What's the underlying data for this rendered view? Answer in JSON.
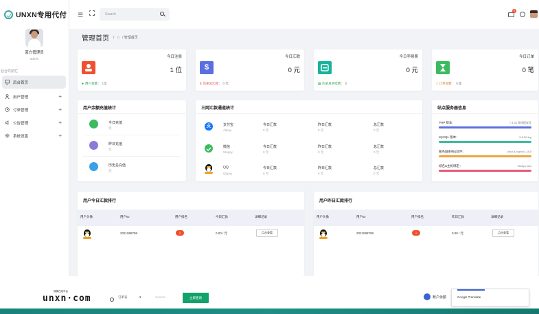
{
  "brand": {
    "name": "UNXN专用代付"
  },
  "user": {
    "name": "蓝方管理员",
    "role": "admin"
  },
  "nav": {
    "section_title": "后台导航栏",
    "items": [
      {
        "label": "后台首页",
        "icon": "monitor-icon",
        "active": true
      },
      {
        "label": "用户管理",
        "icon": "user-icon",
        "expandable": true
      },
      {
        "label": "订单管理",
        "icon": "clock-icon",
        "expandable": true
      },
      {
        "label": "公告管理",
        "icon": "megaphone-icon",
        "expandable": true
      },
      {
        "label": "系统设置",
        "icon": "gear-icon",
        "expandable": true
      }
    ]
  },
  "topbar": {
    "search_placeholder": "Search",
    "mail_badge": "0"
  },
  "page": {
    "title": "管理首页",
    "breadcrumb_sep": "/",
    "breadcrumb_current": "/ 管理首页"
  },
  "stats": [
    {
      "title": "今日注册",
      "value": "1 位",
      "icon_color": "#f0502f",
      "foot_label": "用户总数：",
      "foot_value": "1位",
      "foot_color": "#2a9d4a"
    },
    {
      "title": "今日汇款",
      "value": "0 元",
      "icon_color": "#5b6fe0",
      "foot_label": "历史总汇款：",
      "foot_value": "0 元",
      "foot_color": "#e04a4a"
    },
    {
      "title": "今日手续费",
      "value": "0 元",
      "icon_color": "#17b39a",
      "foot_label": "历史总手续费：",
      "foot_value": "0",
      "foot_color": "#2a9d4a"
    },
    {
      "title": "今日订单",
      "value": "0 笔",
      "icon_color": "#3cbb5e",
      "foot_label": "订单总数：",
      "foot_value": "0 笔",
      "foot_color": "#e07a2a"
    }
  ],
  "recharge": {
    "title": "用户余额充值统计",
    "rows": [
      {
        "label": "今日充值",
        "value": "元",
        "color": "#3cbb5e"
      },
      {
        "label": "昨日充值",
        "value": "元",
        "color": "#8a7bd8"
      },
      {
        "label": "历史总充值",
        "value": "元",
        "color": "#3aa0e8"
      }
    ]
  },
  "channels": {
    "title": "三网汇款通道统计",
    "rows": [
      {
        "name": "支付宝",
        "sub": "Alipay",
        "icon": "alipay-icon",
        "color": "#1677ff",
        "today_label": "今日汇款",
        "today_value": "0 元",
        "yest_label": "昨日汇款",
        "yest_value": "0 元",
        "total_label": "总汇款",
        "total_value": "0 元"
      },
      {
        "name": "微信",
        "sub": "Wepay",
        "icon": "wechat-icon",
        "color": "#3cbb5e",
        "today_label": "今日汇款",
        "today_value": "0 元",
        "yest_label": "昨日汇款",
        "yest_value": "0 元",
        "total_label": "总汇款",
        "total_value": "0 元"
      },
      {
        "name": "QQ",
        "sub": "Qqpay",
        "icon": "qq-icon",
        "color": "#111111",
        "today_label": "今日汇款",
        "today_value": "0 元",
        "yest_label": "昨日汇款",
        "yest_value": "0 元",
        "total_label": "总汇款",
        "total_value": "0 元"
      }
    ]
  },
  "server": {
    "title": "站点服务器信息",
    "rows": [
      {
        "label": "PHP 版本：",
        "value": "7.3.33 非线程安全",
        "color": "#5b6fe0",
        "level": 1
      },
      {
        "label": "MySQL 版本：",
        "value": "5.6.50 log",
        "color": "#3cbb9a",
        "level": 1
      },
      {
        "label": "服务器系统&软件：",
        "value": "Linux & nginx/1.18.0",
        "color": "#f0a33c",
        "level": 1
      },
      {
        "label": "域名&主机绑定：",
        "value": "IIS/Apc test",
        "color": "#e85a7a",
        "level": 1
      }
    ]
  },
  "rank_today": {
    "title": "用户今日汇款排行",
    "headers": [
      "用户头像",
      "用户ID",
      "用户排名",
      "今日汇款",
      "详细记录"
    ],
    "rows": [
      {
        "user_id": "2021088798",
        "rank": "1",
        "amount": "0.00 / 元",
        "action": "点击查看"
      }
    ]
  },
  "rank_yesterday": {
    "title": "用户昨日汇款排行",
    "headers": [
      "用户头像",
      "用户ID",
      "用户排名",
      "昨日汇款",
      "详细记录"
    ],
    "rows": [
      {
        "user_id": "2021088798",
        "rank": "1",
        "amount": "0.00 / 元",
        "action": "点击查看"
      }
    ]
  },
  "footer_overlay": {
    "site_small": "随便在线平台",
    "site_logo": "unxn·com",
    "select_label": "订单号",
    "input_placeholder": "Search...",
    "submit_label": "立即查询",
    "user_label": "账户余额",
    "translate_label": "Google Translate"
  }
}
